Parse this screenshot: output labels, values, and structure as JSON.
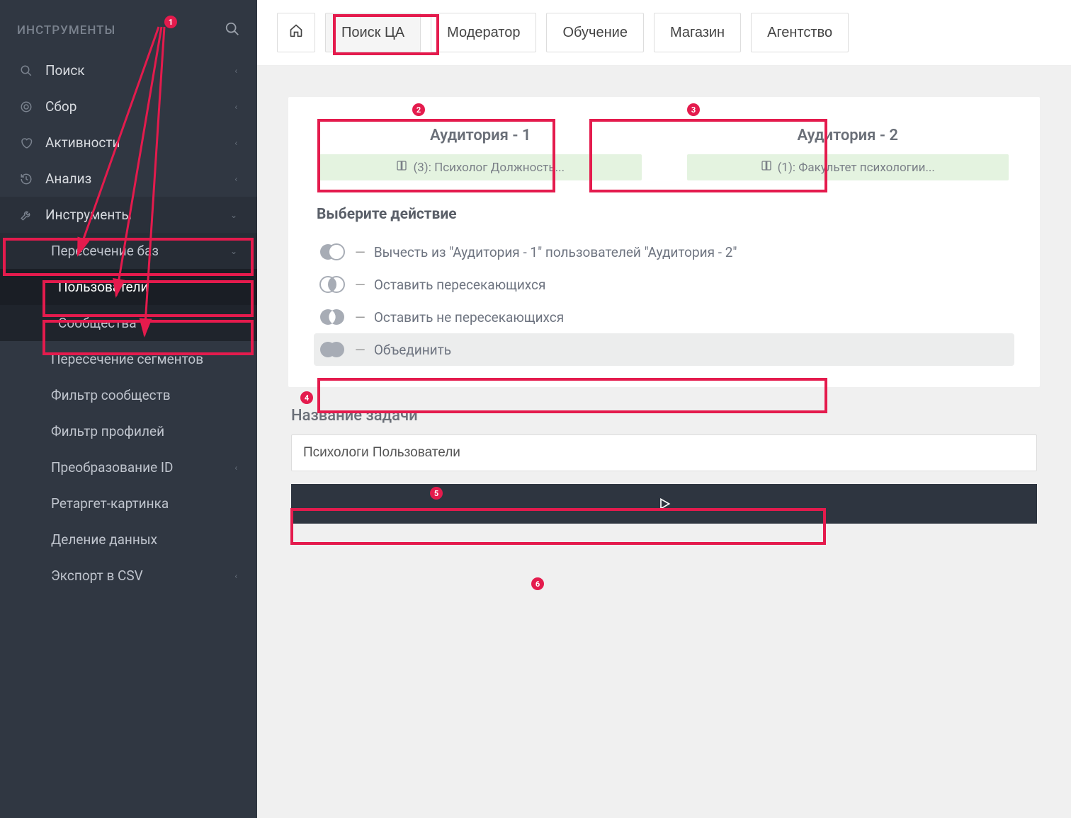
{
  "sidebar": {
    "header": "ИНСТРУМЕНТЫ",
    "items": [
      {
        "label": "Поиск",
        "icon": "search"
      },
      {
        "label": "Сбор",
        "icon": "target"
      },
      {
        "label": "Активности",
        "icon": "heart"
      },
      {
        "label": "Анализ",
        "icon": "history"
      },
      {
        "label": "Инструменты",
        "icon": "wrench"
      }
    ],
    "sub": {
      "intersect": {
        "label": "Пересечение баз"
      },
      "users": {
        "label": "Пользователи"
      },
      "communities": {
        "label": "Сообщества"
      },
      "segments": {
        "label": "Пересечение сегментов"
      },
      "filter_comm": {
        "label": "Фильтр сообществ"
      },
      "filter_prof": {
        "label": "Фильтр профилей"
      },
      "transform_id": {
        "label": "Преобразование ID"
      },
      "retarget": {
        "label": "Ретаргет-картинка"
      },
      "split": {
        "label": "Деление данных"
      },
      "export": {
        "label": "Экспорт в CSV"
      }
    }
  },
  "topnav": {
    "search_ca": "Поиск ЦА",
    "moderator": "Модератор",
    "training": "Обучение",
    "shop": "Магазин",
    "agency": "Агентство"
  },
  "audience1": {
    "title": "Аудитория - 1",
    "chip": "(3): Психолог Должность..."
  },
  "audience2": {
    "title": "Аудитория - 2",
    "chip": "(1): Факультет психологии..."
  },
  "section_action": "Выберите действие",
  "actions": {
    "subtract": "Вычесть из \"Аудитория - 1\" пользователей \"Аудитория - 2\"",
    "intersect": "Оставить пересекающихся",
    "exclude": "Оставить не пересекающихся",
    "union": "Объединить"
  },
  "task": {
    "label": "Название задачи",
    "value": "Психологи Пользователи"
  },
  "dash": "—",
  "annotations": {
    "1": "1",
    "2": "2",
    "3": "3",
    "4": "4",
    "5": "5",
    "6": "6"
  }
}
